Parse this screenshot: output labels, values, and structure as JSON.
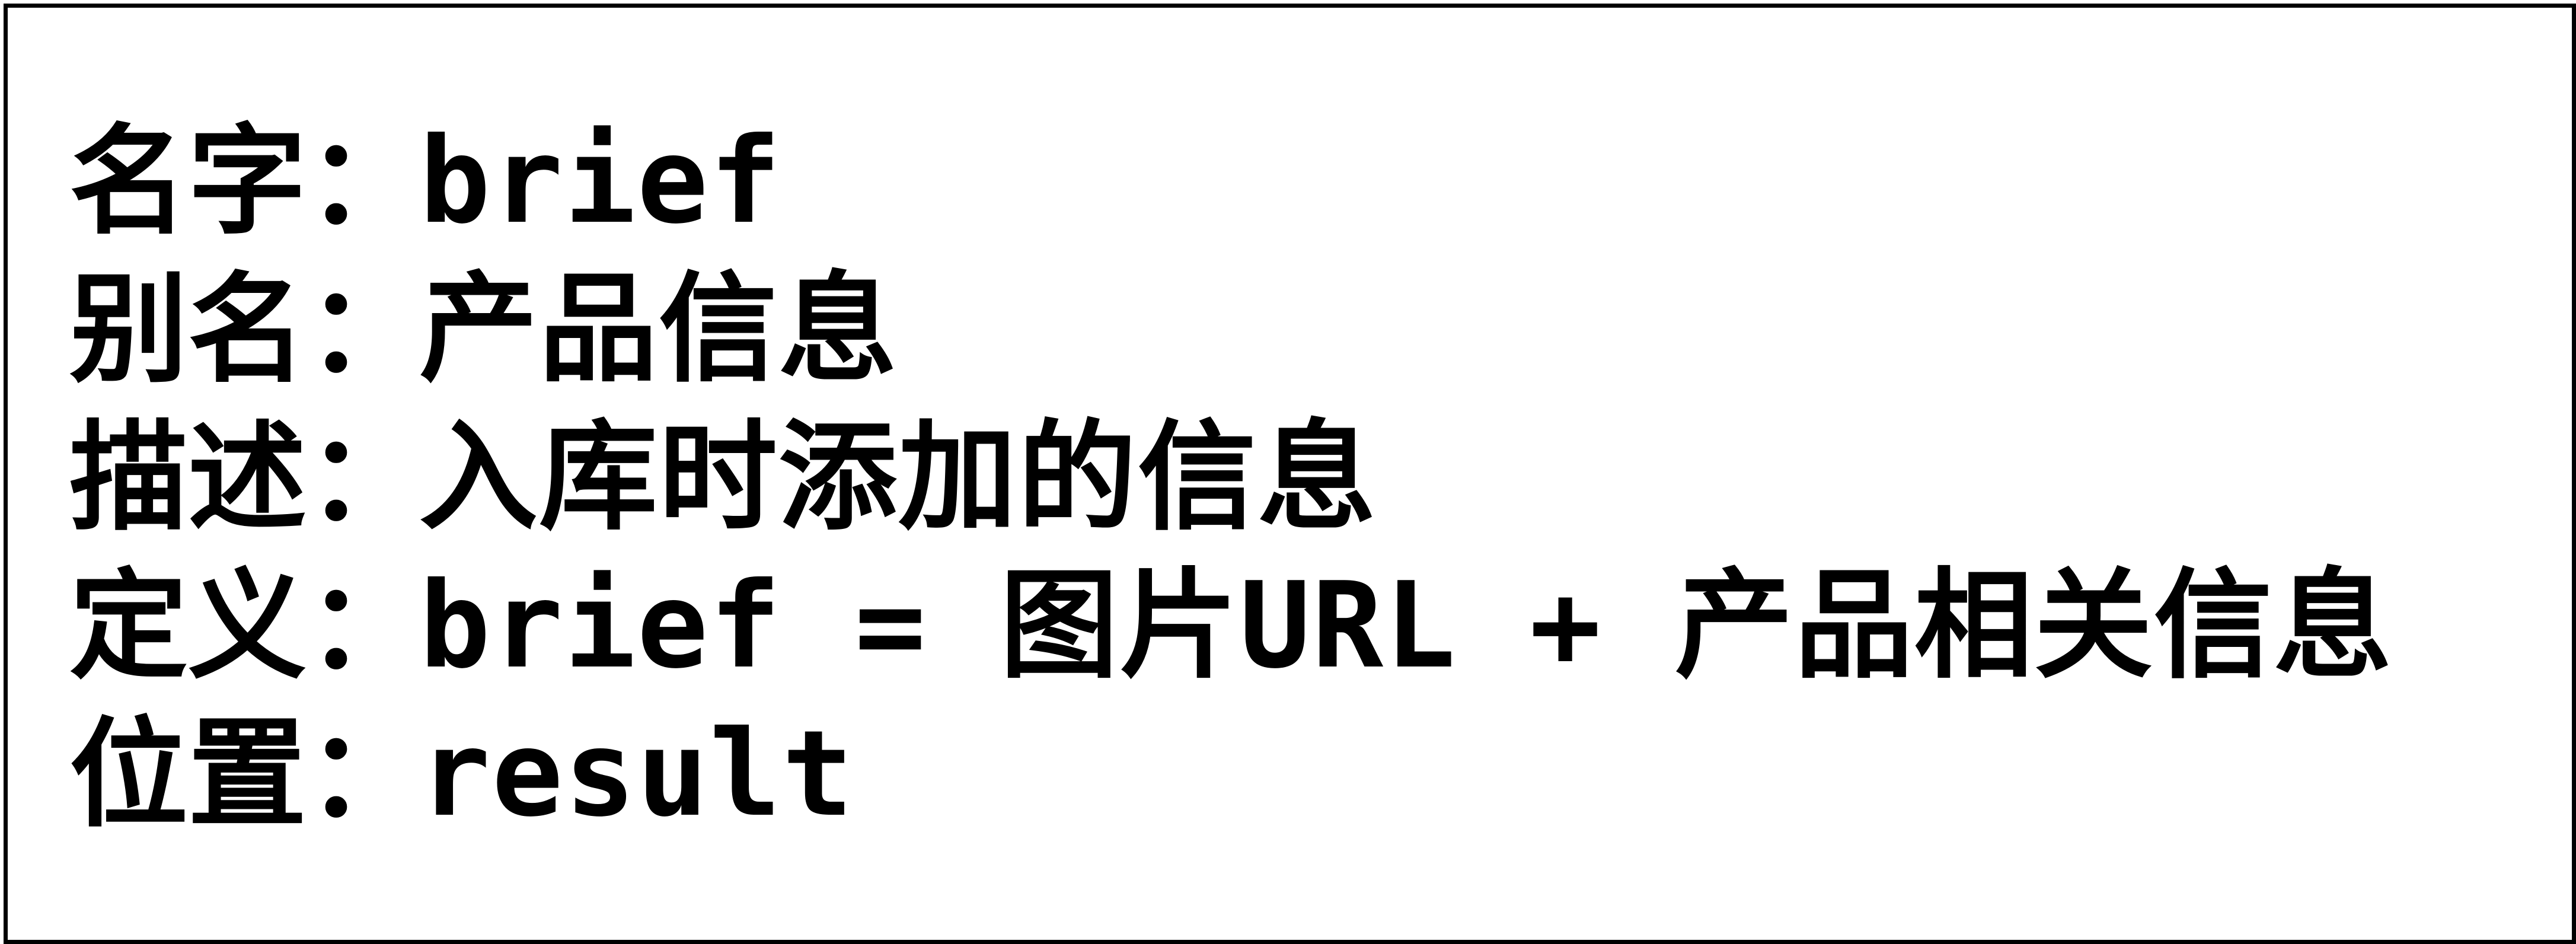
{
  "entries": [
    {
      "label": "名字",
      "separator": "：",
      "value": "brief"
    },
    {
      "label": "别名",
      "separator": "：",
      "value": "产品信息"
    },
    {
      "label": "描述",
      "separator": "：",
      "value": "入库时添加的信息"
    },
    {
      "label": "定义",
      "separator": "：",
      "value": "brief = 图片URL + 产品相关信息"
    },
    {
      "label": "位置",
      "separator": "：",
      "value": "result"
    }
  ]
}
